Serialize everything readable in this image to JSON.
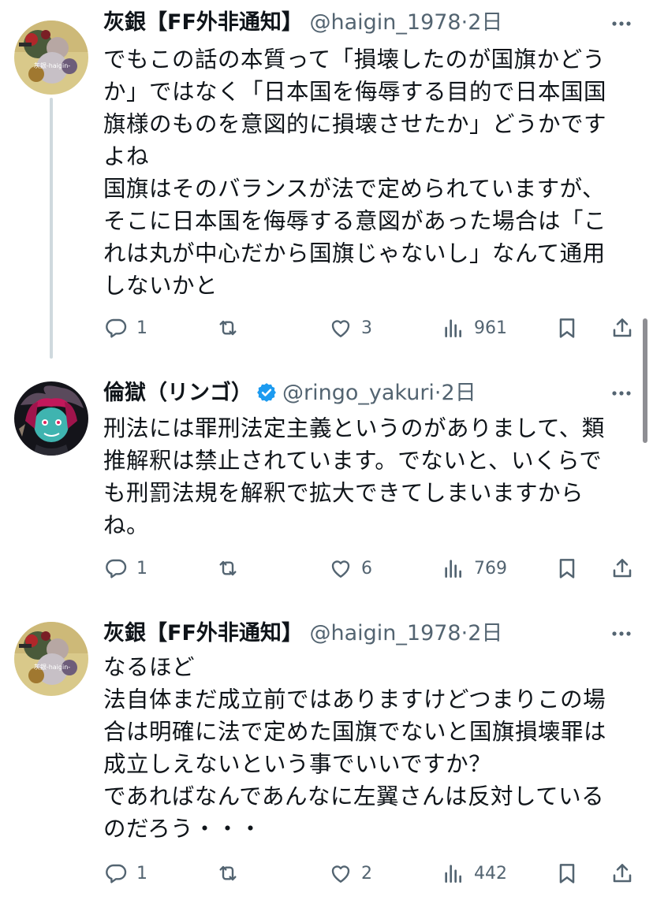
{
  "tweets": [
    {
      "display_name": "灰銀【FF外非通知】",
      "handle": "@haigin_1978",
      "separator": "·",
      "time": "2日",
      "verified": false,
      "lines": [
        "でもこの話の本質って「損壊したのが国旗かどう",
        "か」ではなく「日本国を侮辱する目的で日本国国",
        "旗様のものを意図的に損壊させたか」どうかです",
        "よね",
        "国旗はそのバランスが法で定められていますが、",
        "そこに日本国を侮辱する意図があった場合は「こ",
        "れは丸が中心だから国旗じゃないし」なんて通用",
        "しないかと"
      ],
      "replies": "1",
      "retweets": "",
      "likes": "3",
      "views": "961",
      "avatar_caption": "灰銀-haigin-"
    },
    {
      "display_name": "倫獄（リンゴ）",
      "handle": "@ringo_yakuri",
      "separator": "·",
      "time": "2日",
      "verified": true,
      "lines": [
        "刑法には罪刑法定主義というのがありまして、類",
        "推解釈は禁止されています。でないと、いくらで",
        "も刑罰法規を解釈で拡大できてしまいますから",
        "ね。"
      ],
      "replies": "1",
      "retweets": "",
      "likes": "6",
      "views": "769"
    },
    {
      "display_name": "灰銀【FF外非通知】",
      "handle": "@haigin_1978",
      "separator": "·",
      "time": "2日",
      "verified": false,
      "lines": [
        "なるほど",
        "法自体まだ成立前ではありますけどつまりこの場",
        "合は明確に法で定めた国旗でないと国旗損壊罪は",
        "成立しえないという事でいいですか？",
        "であればなんであんなに左翼さんは反対している",
        "のだろう・・・"
      ],
      "replies": "1",
      "retweets": "",
      "likes": "2",
      "views": "442",
      "avatar_caption": "灰銀-haigin-"
    }
  ],
  "icons": {
    "more": "more-dots-icon",
    "reply": "reply-icon",
    "retweet": "retweet-icon",
    "like": "heart-icon",
    "views": "views-icon",
    "bookmark": "bookmark-icon",
    "share": "share-icon",
    "verified": "verified-badge-icon"
  },
  "colors": {
    "text": "#0f1419",
    "secondary": "#536471",
    "thread_line": "#cfd9de",
    "verified_blue": "#1d9bf0"
  }
}
